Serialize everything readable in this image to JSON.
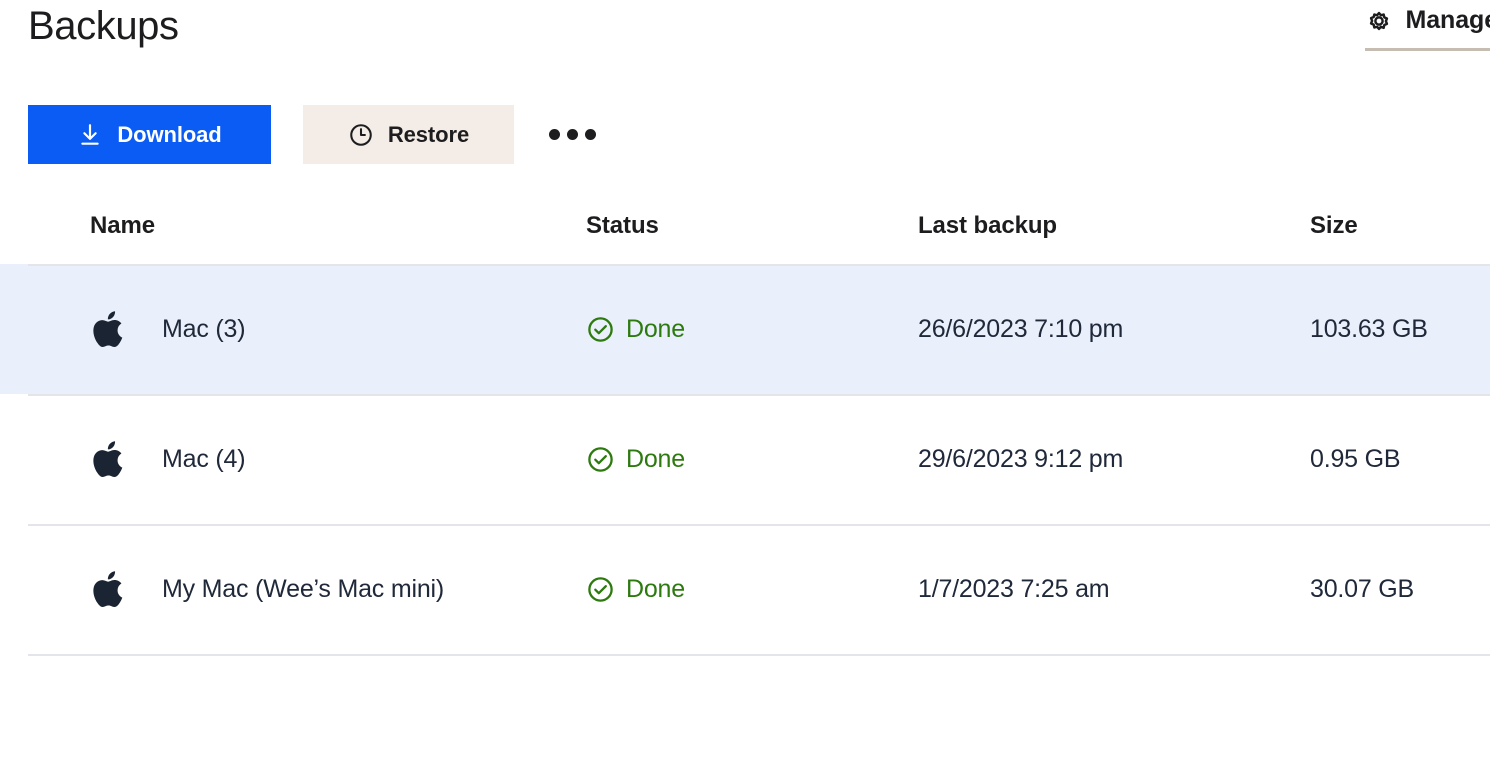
{
  "header": {
    "title": "Backups",
    "manage_label": "Manage",
    "manage_icon": "gear-icon"
  },
  "toolbar": {
    "download_label": "Download",
    "download_icon": "download-arrow-icon",
    "restore_label": "Restore",
    "restore_icon": "clock-restore-icon",
    "more_icon": "ellipsis-icon"
  },
  "table": {
    "columns": [
      {
        "key": "name",
        "label": "Name"
      },
      {
        "key": "status",
        "label": "Status"
      },
      {
        "key": "last_backup",
        "label": "Last backup"
      },
      {
        "key": "size",
        "label": "Size"
      }
    ],
    "rows": [
      {
        "device_icon": "apple-logo-icon",
        "name": "Mac (3)",
        "status": "Done",
        "status_icon": "check-circle-icon",
        "last_backup": "26/6/2023 7:10 pm",
        "size": "103.63 GB",
        "selected": true
      },
      {
        "device_icon": "apple-logo-icon",
        "name": "Mac (4)",
        "status": "Done",
        "status_icon": "check-circle-icon",
        "last_backup": "29/6/2023 9:12 pm",
        "size": "0.95 GB",
        "selected": false
      },
      {
        "device_icon": "apple-logo-icon",
        "name": "My Mac (Wee’s Mac mini)",
        "status": "Done",
        "status_icon": "check-circle-icon",
        "last_backup": "1/7/2023 7:25 am",
        "size": "30.07 GB",
        "selected": false
      }
    ]
  },
  "colors": {
    "accent_blue": "#0a5cf5",
    "restore_beige": "#f4ece6",
    "selected_row": "#e9f0fb",
    "status_green": "#2d7a0f",
    "divider": "#e3e5ea",
    "text_primary": "#1d1d1f",
    "manage_underline": "#c5bdb2"
  }
}
